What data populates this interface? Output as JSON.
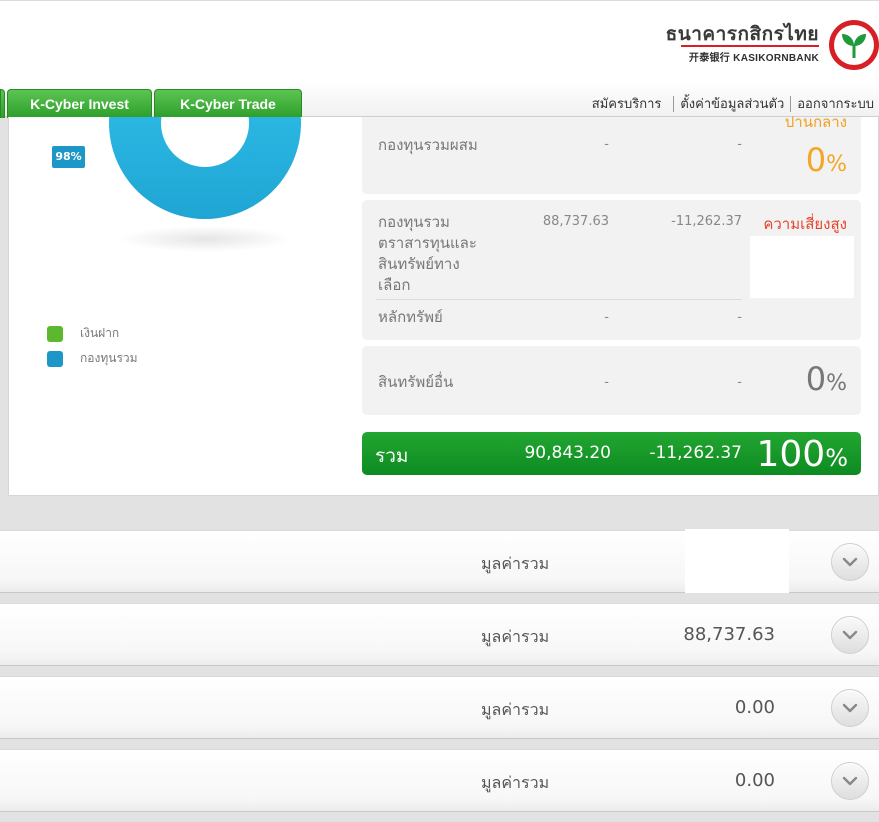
{
  "brand": {
    "thai_name": "ธนาคารกสิกรไทย",
    "english_name": "开泰银行 KASIKORNBANK",
    "accent": "#2da82f",
    "red": "#d71f26"
  },
  "tabs": [
    {
      "label": "K-Cyber Invest"
    },
    {
      "label": "K-Cyber Trade"
    }
  ],
  "topnav": {
    "register": "สมัครบริการ",
    "settings": "ตั้งค่าข้อมูลส่วนตัว",
    "logout": "ออกจากระบบ"
  },
  "chart": {
    "badge": "98%",
    "legend": [
      {
        "label": "เงินฝาก",
        "color": "#5cb82e"
      },
      {
        "label": "กองทุนรวม",
        "color": "#1d97c8"
      }
    ]
  },
  "chart_data": {
    "type": "pie",
    "categories": [
      "เงินฝาก",
      "กองทุนรวม"
    ],
    "values": [
      2,
      98
    ],
    "colors": [
      "#5cb82e",
      "#29b6e6"
    ],
    "title": "",
    "donut": true
  },
  "assets": {
    "mixed_fund": {
      "label": "กองทุนรวมผสม",
      "value": "-",
      "change": "-",
      "risk": "ปานกลาง",
      "pct": "0",
      "pct_unit": "%"
    },
    "alt_fund": {
      "label_lines": [
        "กองทุนรวม",
        "ตราสารทุนและ",
        "สินทรัพย์ทาง",
        "เลือก"
      ],
      "value": "88,737.63",
      "change": "-11,262.37",
      "risk": "ความเสี่ยงสูง"
    },
    "securities": {
      "label": "หลักทรัพย์",
      "value": "-",
      "change": "-"
    },
    "other": {
      "label": "สินทรัพย์อื่น",
      "value": "-",
      "change": "-",
      "pct": "0",
      "pct_unit": "%"
    },
    "total": {
      "label": "รวม",
      "value": "90,843.20",
      "change": "-11,262.37",
      "pct": "100",
      "pct_unit": "%"
    }
  },
  "accordion": [
    {
      "label": "มูลค่ารวม",
      "value": ""
    },
    {
      "label": "มูลค่ารวม",
      "value": "88,737.63"
    },
    {
      "label": "มูลค่ารวม",
      "value": "0.00"
    },
    {
      "label": "มูลค่ารวม",
      "value": "0.00"
    }
  ]
}
